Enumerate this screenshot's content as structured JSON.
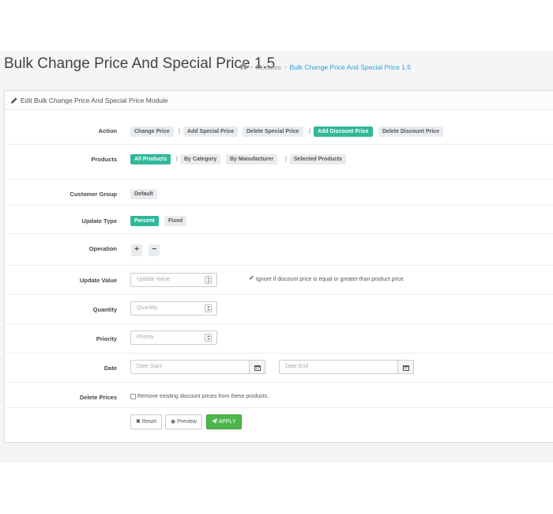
{
  "header": {
    "title": "Bulk Change Price And Special Price 1.5",
    "breadcrumb": {
      "home_icon": "home-icon",
      "modules": "Modules",
      "current": "Bulk Change Price And Special Price 1.5"
    }
  },
  "panel": {
    "heading": "Edit Bulk Change Price And Special Price Module",
    "icon": "pencil-icon"
  },
  "form": {
    "action": {
      "label": "Action",
      "options": [
        "Change Price",
        "Add Special Price",
        "Delete Special Price",
        "Add Discount Price",
        "Delete Discount Price"
      ],
      "selected": "Add Discount Price"
    },
    "products": {
      "label": "Products",
      "options": [
        "All Products",
        "By Category",
        "By Manufacturer",
        "Selected Products"
      ],
      "selected": "All Products"
    },
    "customer_group": {
      "label": "Customer Group",
      "value": "Default"
    },
    "update_type": {
      "label": "Update Type",
      "options": [
        "Percent",
        "Fixed"
      ],
      "selected": "Percent"
    },
    "operation": {
      "label": "Operation",
      "plus": "+",
      "minus": "−"
    },
    "update_value": {
      "label": "Update Value",
      "placeholder": "Update Value",
      "ignore_label": "Ignore if discount price is equal or greater than product price",
      "ignore_checked": true
    },
    "quantity": {
      "label": "Quantity",
      "placeholder": "Quantity"
    },
    "priority": {
      "label": "Priority",
      "placeholder": "Priority"
    },
    "date": {
      "label": "Date",
      "start_placeholder": "Date Start",
      "end_placeholder": "Date End"
    },
    "delete_prices": {
      "label": "Delete Prices",
      "text": "Remove existing discount prices from these products.",
      "checked": false
    }
  },
  "buttons": {
    "reset": "Reset",
    "preview": "Preview",
    "apply": "APPLY"
  },
  "colors": {
    "accent": "#2fb89a",
    "apply": "#4cb648",
    "link": "#2a9fd6"
  }
}
